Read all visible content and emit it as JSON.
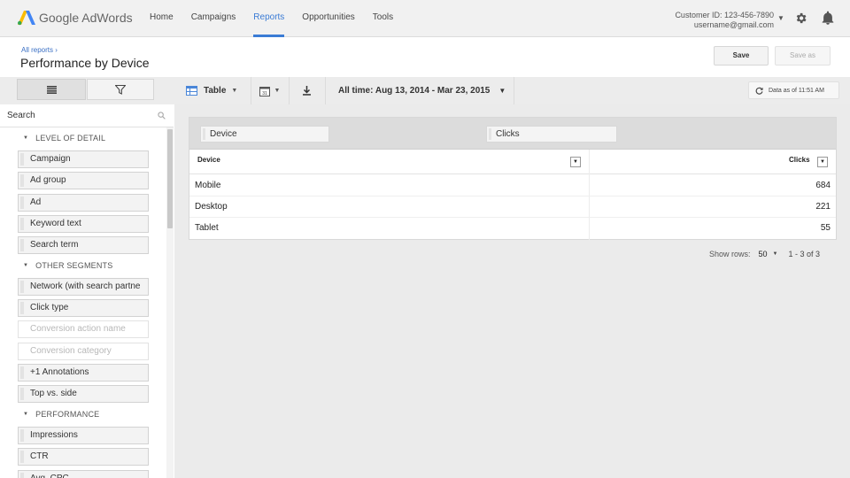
{
  "app": {
    "brand_google": "Google",
    "brand_product": "AdWords"
  },
  "nav": {
    "items": [
      {
        "label": "Home",
        "active": false
      },
      {
        "label": "Campaigns",
        "active": false
      },
      {
        "label": "Reports",
        "active": true
      },
      {
        "label": "Opportunities",
        "active": false
      },
      {
        "label": "Tools",
        "active": false
      }
    ]
  },
  "account": {
    "customer_id": "Customer ID: 123-456-7890",
    "email": "username@gmail.com"
  },
  "header": {
    "breadcrumb": "All reports ›",
    "title": "Performance by Device",
    "save_label": "Save",
    "save_as_label": "Save as"
  },
  "toolbar": {
    "view_label": "Table",
    "calendar_icon_text": "31",
    "date_range": "All time: Aug 13, 2014 - Mar 23, 2015",
    "data_as_of": "Data as of 11:51 AM"
  },
  "sidebar": {
    "search_placeholder": "Search",
    "sections": [
      {
        "title": "LEVEL OF DETAIL",
        "items": [
          {
            "label": "Campaign",
            "disabled": false
          },
          {
            "label": "Ad group",
            "disabled": false
          },
          {
            "label": "Ad",
            "disabled": false
          },
          {
            "label": "Keyword text",
            "disabled": false
          },
          {
            "label": "Search term",
            "disabled": false
          }
        ]
      },
      {
        "title": "OTHER SEGMENTS",
        "items": [
          {
            "label": "Network (with search partne",
            "disabled": false
          },
          {
            "label": "Click type",
            "disabled": false
          },
          {
            "label": "Conversion action name",
            "disabled": true
          },
          {
            "label": "Conversion category",
            "disabled": true
          },
          {
            "label": "+1 Annotations",
            "disabled": false
          },
          {
            "label": "Top vs. side",
            "disabled": false
          }
        ]
      },
      {
        "title": "PERFORMANCE",
        "items": [
          {
            "label": "Impressions",
            "disabled": false
          },
          {
            "label": "CTR",
            "disabled": false
          },
          {
            "label": "Avg. CPC",
            "disabled": false
          }
        ]
      }
    ]
  },
  "report": {
    "pivot_rows_chip": "Device",
    "pivot_values_chip": "Clicks",
    "columns": [
      "Device",
      "Clicks"
    ],
    "rows": [
      {
        "device": "Mobile",
        "clicks": "684"
      },
      {
        "device": "Desktop",
        "clicks": "221"
      },
      {
        "device": "Tablet",
        "clicks": "55"
      }
    ],
    "show_rows_label": "Show rows:",
    "show_rows_value": "50",
    "range_label": "1 - 3 of 3"
  },
  "colors": {
    "accent": "#3a7bd5",
    "logo_blue": "#4285f4",
    "logo_yellow": "#fbbc05",
    "logo_green": "#34a853",
    "table_icon": "#4a86d8"
  }
}
